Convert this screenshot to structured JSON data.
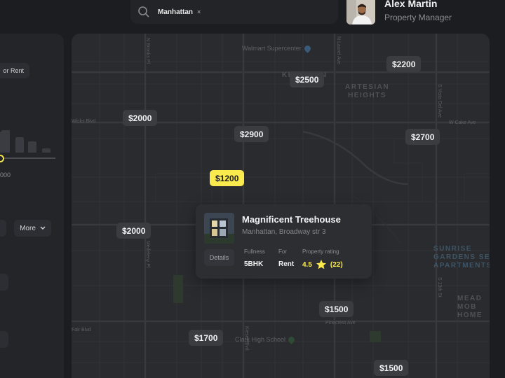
{
  "search": {
    "chip_label": "Manhattan",
    "chip_remove": "×"
  },
  "profile": {
    "name": "Alex Martin",
    "role": "Property Manager"
  },
  "filters": {
    "listing_type_partial": "or Rent",
    "price_min_partial": "000",
    "more_label": "More"
  },
  "map": {
    "labels": {
      "walmart": "Walmart Supercenter",
      "kingston": "KINGSTON",
      "artesian": "ARTESIAN\nHEIGHTS",
      "sunrise": "SUNRISE\nGARDENS SENIOR\nAPARTMENTS",
      "meadow": "MEAD\nMOB\nHOME",
      "clark": "Clark High School",
      "pinecrest": "Pinecrest Ave",
      "wicks": "Wicks Blvd",
      "wiccake": "W Cake Ave",
      "sr13": "S 13th St",
      "nlaw": "N Laurel Ave",
      "slaw": "S Vista Del Ave",
      "nbrooks": "N Brooks Pl",
      "medeleny": "Medeleny Pl",
      "fair": "Fair Blvd",
      "kiesel": "Kiesel Blvd"
    },
    "prices": [
      {
        "id": "p2500",
        "label": "$2500"
      },
      {
        "id": "p2200",
        "label": "$2200"
      },
      {
        "id": "p2000a",
        "label": "$2000"
      },
      {
        "id": "p2900",
        "label": "$2900"
      },
      {
        "id": "p2700",
        "label": "$2700"
      },
      {
        "id": "p1200",
        "label": "$1200",
        "active": true
      },
      {
        "id": "p2000b",
        "label": "$2000"
      },
      {
        "id": "p1500a",
        "label": "$1500"
      },
      {
        "id": "p1700",
        "label": "$1700"
      },
      {
        "id": "p1500b",
        "label": "$1500"
      }
    ]
  },
  "card": {
    "title": "Magnificent Treehouse",
    "address": "Manhattan, Broadway str 3",
    "details_label": "Details",
    "fullness_label": "Fullness",
    "fullness_value": "5BHK",
    "for_label": "For",
    "for_value": "Rent",
    "rating_label": "Property rating",
    "rating_value": "4.5",
    "rating_count": "(22)"
  },
  "colors": {
    "accent": "#fbea4d",
    "background": "#1c1d20",
    "map": "#2a2b2e",
    "pill": "#3b3c40"
  },
  "icons": {
    "search": "search-icon",
    "close": "close-icon",
    "star": "star-icon",
    "chevron": "chevron-down-icon"
  }
}
